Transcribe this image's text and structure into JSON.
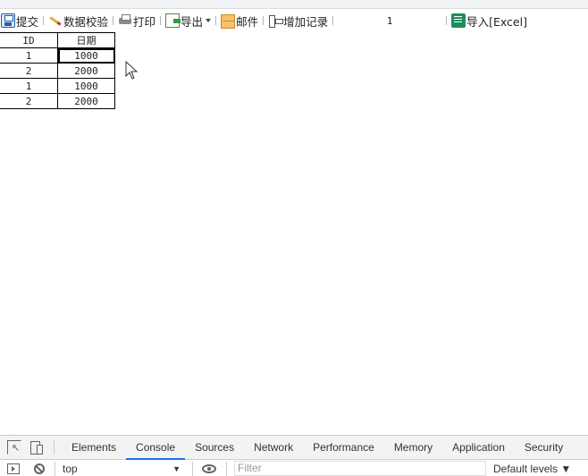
{
  "toolbar": {
    "items": [
      {
        "label": "提交",
        "icon": "save-icon"
      },
      {
        "label": "数据校验",
        "icon": "check-icon"
      },
      {
        "label": "打印",
        "icon": "print-icon"
      },
      {
        "label": "导出",
        "icon": "export-icon"
      },
      {
        "label": "邮件",
        "icon": "mail-icon"
      },
      {
        "label": "增加记录",
        "icon": "add-record-icon"
      }
    ],
    "page_number": "1",
    "import_label": "导入[Excel]"
  },
  "report_table": {
    "columns": [
      "ID",
      "日期"
    ],
    "rows": [
      [
        "1",
        "1000"
      ],
      [
        "2",
        "2000"
      ],
      [
        "1",
        "1000"
      ],
      [
        "2",
        "2000"
      ]
    ]
  },
  "devtools": {
    "tabs": [
      "Elements",
      "Console",
      "Sources",
      "Network",
      "Performance",
      "Memory",
      "Application",
      "Security"
    ],
    "active_tab": "Console",
    "context": "top",
    "filter_placeholder": "Filter",
    "levels": "Default levels ▼"
  },
  "colors": {
    "accent": "#1a73e8",
    "excel": "#1e8d5b"
  }
}
